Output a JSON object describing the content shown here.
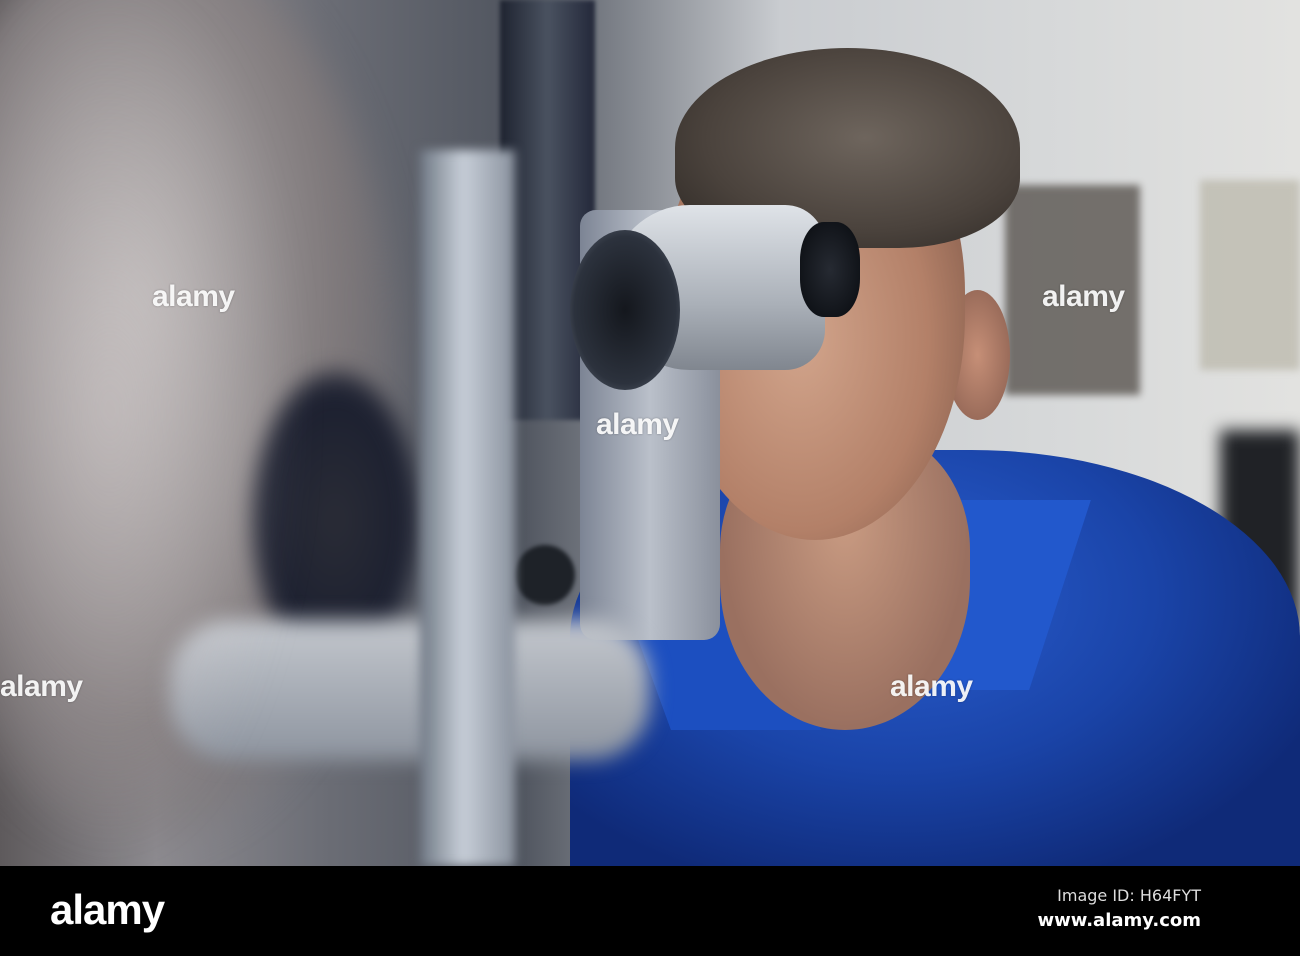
{
  "photo": {
    "description_tag": "man-at-slit-lamp"
  },
  "watermarks": [
    "alamy",
    "alamy",
    "alamy",
    "alamy",
    "alamy"
  ],
  "footer": {
    "logo": "alamy",
    "image_id": "Image ID: H64FYT",
    "site": "www.alamy.com"
  }
}
